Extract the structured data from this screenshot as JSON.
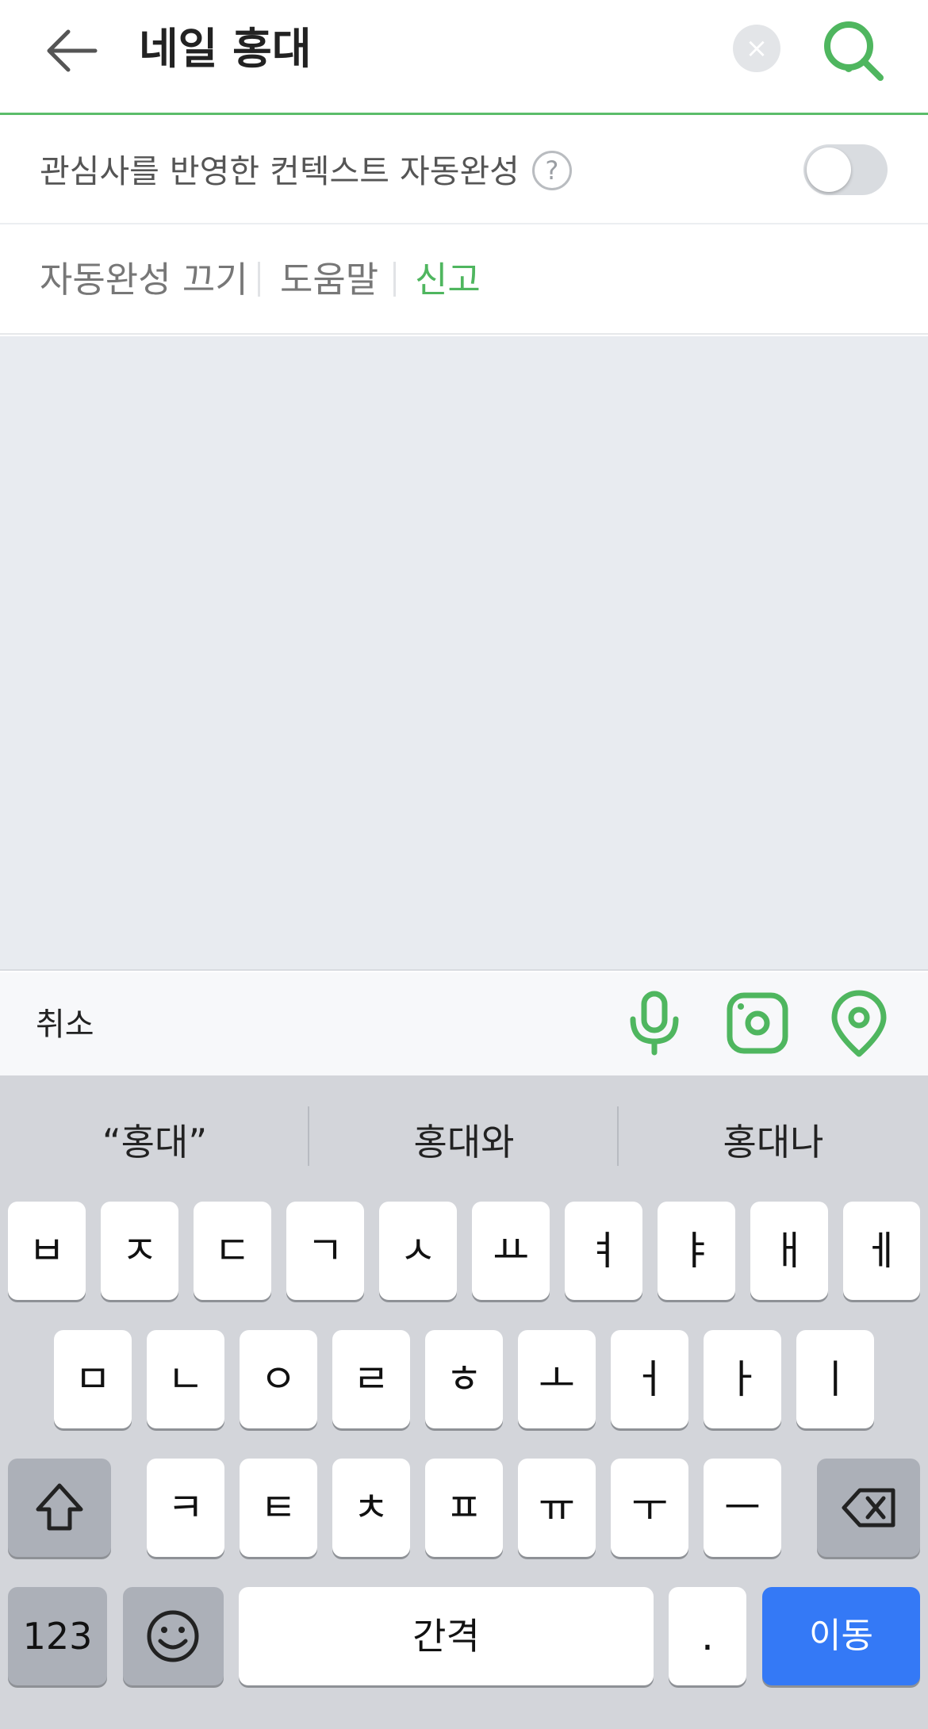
{
  "header": {
    "query": "네일 홍대",
    "clear_glyph": "×"
  },
  "context": {
    "label": "관심사를 반영한 컨텍스트 자동완성",
    "help_glyph": "?",
    "toggle_on": false
  },
  "options": [
    {
      "label": "자동완성 끄기",
      "color": "#777777"
    },
    {
      "label": "도움말",
      "color": "#777777"
    },
    {
      "label": "신고",
      "color": "#4fb65f"
    }
  ],
  "toolbar": {
    "cancel": "취소",
    "icons": [
      "microphone-icon",
      "camera-lens-icon",
      "location-pin-icon"
    ]
  },
  "keyboard": {
    "suggestions": [
      "“홍대”",
      "홍대와",
      "홍대나"
    ],
    "row1": [
      "ㅂ",
      "ㅈ",
      "ㄷ",
      "ㄱ",
      "ㅅ",
      "ㅛ",
      "ㅕ",
      "ㅑ",
      "ㅐ",
      "ㅔ"
    ],
    "row2": [
      "ㅁ",
      "ㄴ",
      "ㅇ",
      "ㄹ",
      "ㅎ",
      "ㅗ",
      "ㅓ",
      "ㅏ",
      "ㅣ"
    ],
    "row3": [
      "ㅋ",
      "ㅌ",
      "ㅊ",
      "ㅍ",
      "ㅠ",
      "ㅜ",
      "ㅡ"
    ],
    "numbers": "123",
    "space": "간격",
    "period": ".",
    "go": "이동"
  },
  "colors": {
    "accent": "#5bbd6a",
    "go_button": "#3479f6",
    "keyboard_bg": "#d3d5da"
  }
}
